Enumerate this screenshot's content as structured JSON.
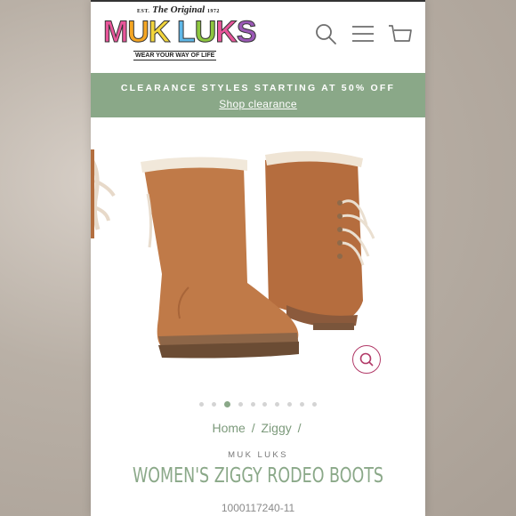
{
  "brand": {
    "est_prefix": "EST.",
    "est_script": "The Original",
    "est_year": "1972",
    "name_part1": "MUK",
    "name_part2": "LUKS",
    "tagline": "WEAR YOUR WAY OF LIFE",
    "colors": [
      "#e8559a",
      "#f5a623",
      "#f2d53c",
      "#5fb8e8",
      "#8dc63f",
      "#9b59b6"
    ]
  },
  "header_icons": [
    "search-icon",
    "menu-icon",
    "cart-icon"
  ],
  "banner": {
    "promo": "CLEARANCE STYLES STARTING AT 50% OFF",
    "link": "Shop clearance",
    "color": "#8aa888"
  },
  "gallery": {
    "dots_total": 10,
    "active_index": 2,
    "zoom_icon": "zoom-icon"
  },
  "breadcrumb": {
    "home": "Home",
    "category": "Ziggy",
    "separator": "/"
  },
  "product": {
    "vendor": "MUK LUKS",
    "title": "WOMEN'S ZIGGY RODEO BOOTS",
    "sku": "1000117240-11"
  },
  "accent_color": "#8aa888",
  "zoom_color": "#b23a68"
}
